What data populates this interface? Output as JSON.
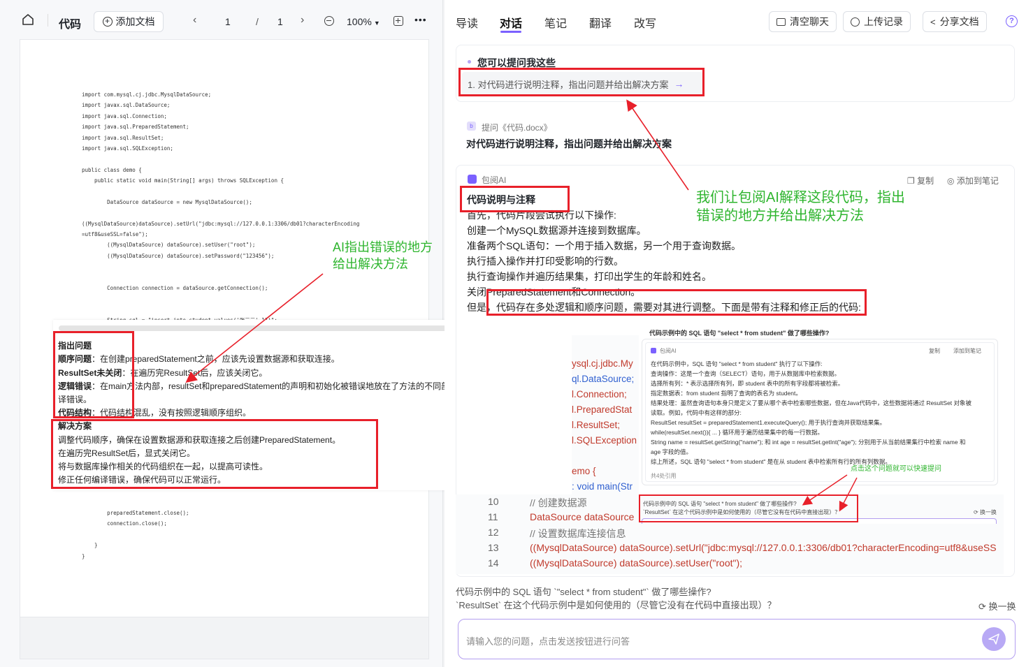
{
  "left": {
    "title": "代码",
    "add_doc": "添加文档",
    "page_current": "1",
    "page_sep": "/",
    "page_total": "1",
    "zoom": "100%",
    "more": "•••",
    "code_lines": [
      "import com.mysql.cj.jdbc.MysqlDataSource;",
      "import javax.sql.DataSource;",
      "import java.sql.Connection;",
      "import java.sql.PreparedStatement;",
      "import java.sql.ResultSet;",
      "import java.sql.SQLException;",
      "",
      "public class demo {",
      "    public static void main(String[] args) throws SQLException {",
      "",
      "        DataSource dataSource = new MysqlDataSource();",
      "",
      "((MysqlDataSource)dataSource).setUrl(\"jdbc:mysql://127.0.0.1:3306/db01?characterEncoding",
      "=utf8&useSSL=false\");",
      "        ((MysqlDataSource) dataSource).setUser(\"root\");",
      "        ((MysqlDataSource) dataSource).setPassword(\"123456\");",
      "",
      "",
      "        Connection connection = dataSource.getConnection();",
      "",
      "",
      "        String sql = \"insert into student values('张三三',11)\";"
    ],
    "code_tail": [
      "        preparedStatement.close();",
      "        connection.close();",
      "",
      "    }",
      "}"
    ]
  },
  "overlay_issues": {
    "heading1": "指出问题",
    "i1_label": "顺序问题",
    "i1_text": "：在创建preparedStatement之前，应该先设置数据源和获取连接。",
    "i2_label": "ResultSet未关闭",
    "i2_text": "：在遍历完ResultSet后，应该关闭它。",
    "i3_label": "逻辑错误",
    "i3_text": "：在main方法内部，resultSet和preparedStatement的声明和初始化被错误地放在了方法的不同部分，这会导致编",
    "i3_text2": "译错误。",
    "i4_label": "代码结构",
    "i4_text": "：代码结构混乱，没有按照逻辑顺序组织。",
    "heading2": "解决方案",
    "s1": "调整代码顺序，确保在设置数据源和获取连接之后创建PreparedStatement。",
    "s2": "在遍历完ResultSet后，显式关闭它。",
    "s3": "将与数据库操作相关的代码组织在一起，以提高可读性。",
    "s4": "修正任何编译错误，确保代码可以正常运行。"
  },
  "annotations": {
    "left_note_1": "AI指出错误的地方",
    "left_note_2": "给出解决方法",
    "right_note_1": "我们让包阅AI解释这段代码，指出",
    "right_note_2": "错误的地方并给出解决方法",
    "popup_note": "点击这个问题就可以快速提问"
  },
  "right": {
    "tabs": [
      "导读",
      "对话",
      "笔记",
      "翻译",
      "改写"
    ],
    "clear_chat": "清空聊天",
    "upload_history": "上传记录",
    "share_doc": "分享文档",
    "help": "?",
    "suggest_title": "您可以提问我这些",
    "suggest_1": "1. 对代码进行说明注释，指出问题并给出解决方案",
    "question_meta": "提问《代码.docx》",
    "question_text": "对代码进行说明注释，指出问题并给出解决方案",
    "ai_name": "包阅AI",
    "copy": "复制",
    "add_note": "添加到笔记",
    "answer_heading": "代码说明与注释",
    "answer_lines": [
      "首先，代码片段尝试执行以下操作:",
      "创建一个MySQL数据源并连接到数据库。",
      "准备两个SQL语句：一个用于插入数据，另一个用于查询数据。",
      "执行插入操作并打印受影响的行数。",
      "执行查询操作并遍历结果集，打印出学生的年龄和姓名。",
      "关闭PreparedStatement和Connection。",
      "但是，代码存在多处逻辑和顺序问题，需要对其进行调整。下面是带有注释和修正后的代码:"
    ],
    "code_snips": [
      "ysql.cj.jdbc.My",
      "ql.DataSource;",
      "l.Connection;",
      "l.PreparedStat",
      "l.ResultSet;",
      "l.SQLException",
      "",
      "emo {",
      ": void main(Str"
    ],
    "code_rows": [
      {
        "n": "10",
        "t": "// 创建数据源"
      },
      {
        "n": "11",
        "t": "DataSource dataSource"
      },
      {
        "n": "12",
        "t": "// 设置数据库连接信息"
      },
      {
        "n": "13",
        "t": "((MysqlDataSource) dataSource).setUrl(\"jdbc:mysql://127.0.0.1:3306/db01?characterEncoding=utf8&useSS"
      },
      {
        "n": "14",
        "t": "((MysqlDataSource) dataSource).setUser(\"root\");"
      }
    ],
    "popup_title": "代码示例中的 SQL 语句 \"select * from student\" 做了哪些操作?",
    "popup_ai": "包阅AI",
    "popup_copy": "复制",
    "popup_note": "添加到笔记",
    "popup_lines": [
      "在代码示例中，SQL 语句 \"select * from student\" 执行了以下操作:",
      "查询操作：这是一个查询（SELECT）语句，用于从数据库中检索数据。",
      "选择所有列：* 表示选择所有列，即 student 表中的所有字段都将被检索。",
      "指定数据表：from student 指明了查询的表名为 student。",
      "结果处理：虽然查询语句本身只是定义了要从哪个表中检索哪些数据，但在Java代码中，这些数据将通过 ResultSet 对象被",
      "读取。例如，代码中有这样的部分:",
      "ResultSet resultSet = preparedStatement1.executeQuery(); 用于执行查询并获取结果集。",
      "while(resultSet.next()){ ... } 循环用于遍历结果集中的每一行数据。",
      "String name = resultSet.getString(\"name\"); 和 int age = resultSet.getInt(\"age\"); 分别用于从当前结果集行中检索 name 和",
      "age 字段的值。",
      "综上所述，SQL 语句 \"select * from student\" 是在从 student 表中检索所有行的所有列数据。"
    ],
    "popup_refs": "共4处引用",
    "popup_q1": "代码示例中的 SQL 语句 \"select * from student\" 做了哪些操作?",
    "popup_q2": "`ResultSet` 在这个代码示例中是如何使用的（尽管它没有在代码中直接出现）？",
    "popup_refresh": "换一换",
    "bottom_q1": "代码示例中的 SQL 语句 `\"select * from student\"` 做了哪些操作?",
    "bottom_q2": "`ResultSet` 在这个代码示例中是如何使用的（尽管它没有在代码中直接出现）？",
    "refresh": "换一换",
    "input_placeholder": "请输入您的问题，点击发送按钮进行问答"
  },
  "colors": {
    "accent": "#7b61ff",
    "annotation_red": "#e8202a",
    "annotation_green": "#2fb52f",
    "code_red": "#c0392b",
    "code_blue": "#3060d0",
    "code_green": "#2e9d4b"
  }
}
